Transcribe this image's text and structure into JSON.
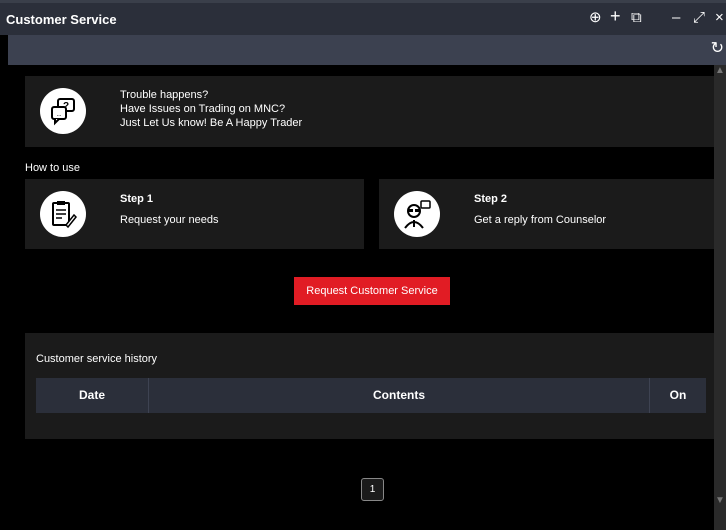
{
  "window": {
    "title": "Customer Service"
  },
  "controls": {
    "add_tab": "⊕",
    "plus": "+",
    "copy": "⧉",
    "minimize": "–",
    "maximize": "⤢",
    "close": "×",
    "refresh": "↻"
  },
  "intro": {
    "line1": "Trouble happens?",
    "line2": "Have Issues on Trading on MNC?",
    "line3": "Just Let Us know! Be A Happy Trader"
  },
  "how_to": "How to use",
  "steps": [
    {
      "title": "Step 1",
      "text": "Request your needs"
    },
    {
      "title": "Step 2",
      "text": "Get a reply from Counselor"
    }
  ],
  "request_button": "Request Customer Service",
  "history": {
    "title": "Customer service history",
    "columns": [
      "Date",
      "Contents",
      "On"
    ]
  },
  "pagination": {
    "current": "1"
  },
  "colors": {
    "accent": "#e11c24",
    "panel": "#1b1b1b",
    "header": "#2b2f3a"
  }
}
